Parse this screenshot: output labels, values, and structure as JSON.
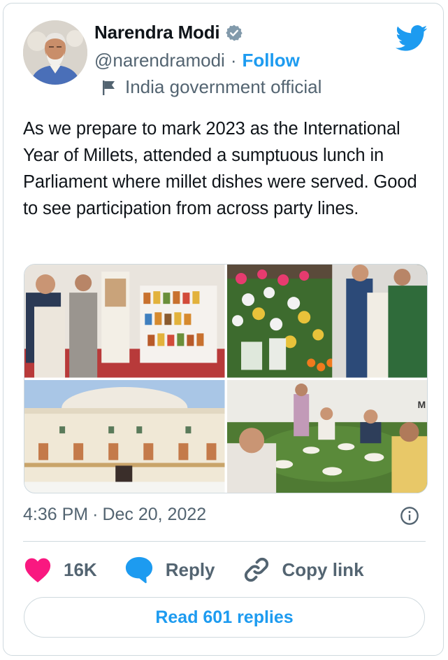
{
  "author": {
    "name": "Narendra Modi",
    "handle": "@narendramodi",
    "separator": "·",
    "follow_label": "Follow",
    "label": "India government official",
    "verified": true
  },
  "tweet": {
    "text": "As we prepare to mark 2023 as the International Year of Millets, attended a sumptuous lunch in Parliament where millet dishes were served. Good to see participation from across party lines.",
    "time": "4:36 PM",
    "date_separator": "·",
    "date": "Dec 20, 2022"
  },
  "media": [
    {
      "name": "photo-millet-exhibit"
    },
    {
      "name": "photo-flower-display"
    },
    {
      "name": "photo-parliament-building"
    },
    {
      "name": "photo-lunch-table"
    }
  ],
  "actions": {
    "like_count": "16K",
    "reply_label": "Reply",
    "copy_label": "Copy link"
  },
  "read_replies_label": "Read 601 replies",
  "colors": {
    "accent": "#1d9bf0",
    "like": "#f91880",
    "secondary_text": "#536471",
    "border": "#cfd9de"
  },
  "icons": [
    "verified-badge-icon",
    "twitter-bird-icon",
    "flag-icon",
    "info-icon",
    "heart-icon",
    "reply-bubble-icon",
    "link-icon"
  ]
}
